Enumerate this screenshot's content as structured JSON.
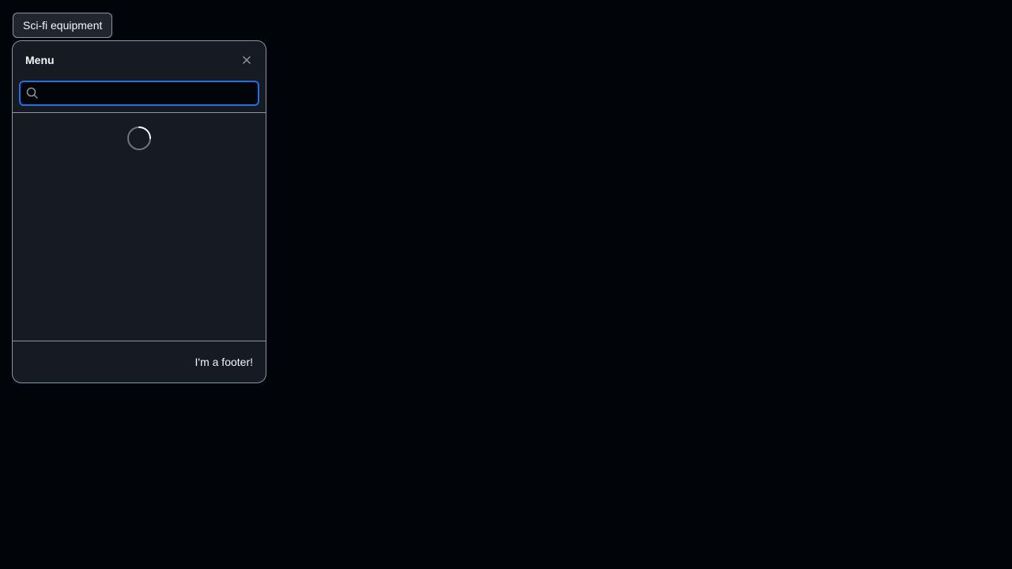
{
  "trigger": {
    "label": "Sci-fi equipment"
  },
  "panel": {
    "title": "Menu",
    "close_icon": "close-icon",
    "search": {
      "value": "",
      "placeholder": "",
      "icon": "search-icon"
    },
    "loading": true,
    "footer_text": "I'm a footer!"
  },
  "colors": {
    "page_background": "#010409",
    "panel_background": "#161b22",
    "border": "#8b949e",
    "focus_accent": "#1f6feb",
    "text": "#f0f6fc",
    "muted": "#8b949e"
  }
}
